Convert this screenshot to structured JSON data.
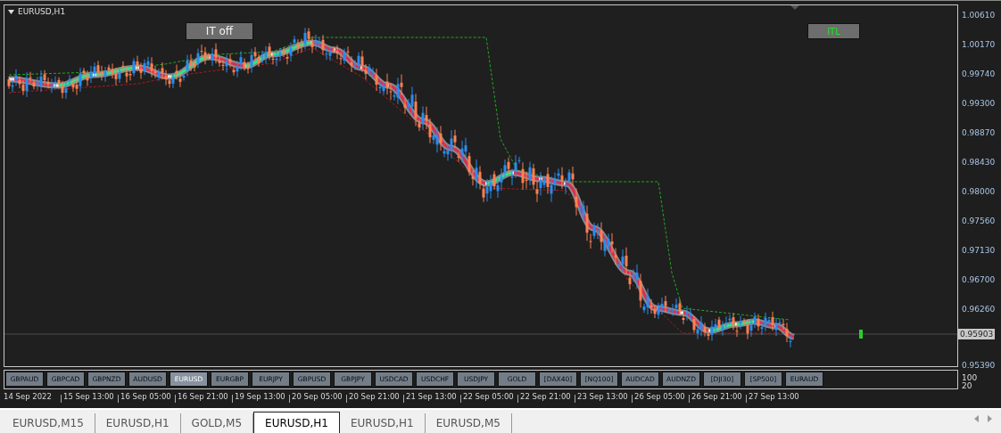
{
  "chart": {
    "title": "EURUSD,H1",
    "buttons": [
      {
        "label": "IT off",
        "kind": "plain"
      },
      {
        "label": "ITL",
        "kind": "signal"
      }
    ],
    "price_ticks": [
      "1.00610",
      "1.00170",
      "0.99740",
      "0.99300",
      "0.98870",
      "0.98430",
      "0.98000",
      "0.97560",
      "0.97130",
      "0.96700",
      "0.96260",
      "0.95390"
    ],
    "current_price": "0.95903"
  },
  "symbol_buttons": [
    {
      "label": "GBPAUD",
      "selected": false
    },
    {
      "label": "GBPCAD",
      "selected": false
    },
    {
      "label": "GBPNZD",
      "selected": false
    },
    {
      "label": "AUDUSD",
      "selected": false
    },
    {
      "label": "EURUSD",
      "selected": true
    },
    {
      "label": "EURGBP",
      "selected": false
    },
    {
      "label": "EURJPY",
      "selected": false
    },
    {
      "label": "GBPUSD",
      "selected": false
    },
    {
      "label": "GBPJPY",
      "selected": false
    },
    {
      "label": "USDCAD",
      "selected": false
    },
    {
      "label": "USDCHF",
      "selected": false
    },
    {
      "label": "USDJPY",
      "selected": false
    },
    {
      "label": "GOLD",
      "selected": false
    },
    {
      "label": "[DAX40]",
      "selected": false
    },
    {
      "label": "[NQ100]",
      "selected": false
    },
    {
      "label": "AUDCAD",
      "selected": false
    },
    {
      "label": "AUDNZD",
      "selected": false
    },
    {
      "label": "[DJI30]",
      "selected": false
    },
    {
      "label": "[SP500]",
      "selected": false
    },
    {
      "label": "EURAUD",
      "selected": false
    }
  ],
  "indicator_scale": [
    "100",
    "20"
  ],
  "time_labels": [
    "14 Sep 2022",
    "15 Sep 13:00",
    "16 Sep 05:00",
    "16 Sep 21:00",
    "19 Sep 13:00",
    "20 Sep 05:00",
    "20 Sep 21:00",
    "21 Sep 13:00",
    "22 Sep 05:00",
    "22 Sep 21:00",
    "23 Sep 13:00",
    "26 Sep 05:00",
    "26 Sep 21:00",
    "27 Sep 13:00"
  ],
  "tabs": [
    {
      "label": "EURUSD,M15",
      "selected": false
    },
    {
      "label": "EURUSD,H1",
      "selected": false
    },
    {
      "label": "GOLD,M5",
      "selected": false
    },
    {
      "label": "EURUSD,H1",
      "selected": true
    },
    {
      "label": "EURUSD,H1",
      "selected": false
    },
    {
      "label": "EURUSD,M5",
      "selected": false
    }
  ]
}
